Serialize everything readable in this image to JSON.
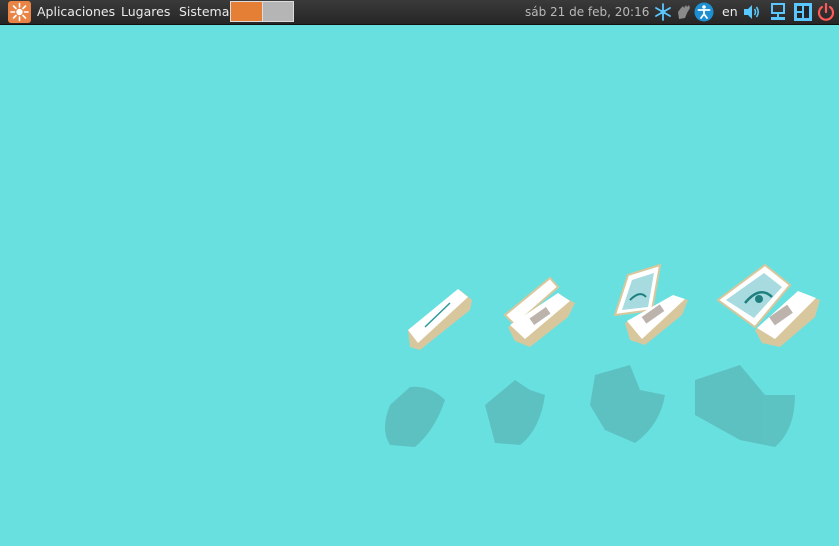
{
  "panel": {
    "menus": {
      "applications": "Aplicaciones",
      "places": "Lugares",
      "system": "Sistema"
    },
    "workspaces": [
      {
        "active": true,
        "color": "#e57f35"
      },
      {
        "active": false,
        "color": "#b5b5b5"
      }
    ],
    "clock": "sáb 21 de feb, 20:16",
    "keyboard_layout": "en",
    "tray_icons": [
      "snowflake-icon",
      "hand-icon",
      "accessibility-icon",
      "volume-icon",
      "network-icon",
      "update-icon",
      "power-icon"
    ]
  },
  "desktop": {
    "background_color": "#68e0e0",
    "brand_color": "#e57f35"
  }
}
